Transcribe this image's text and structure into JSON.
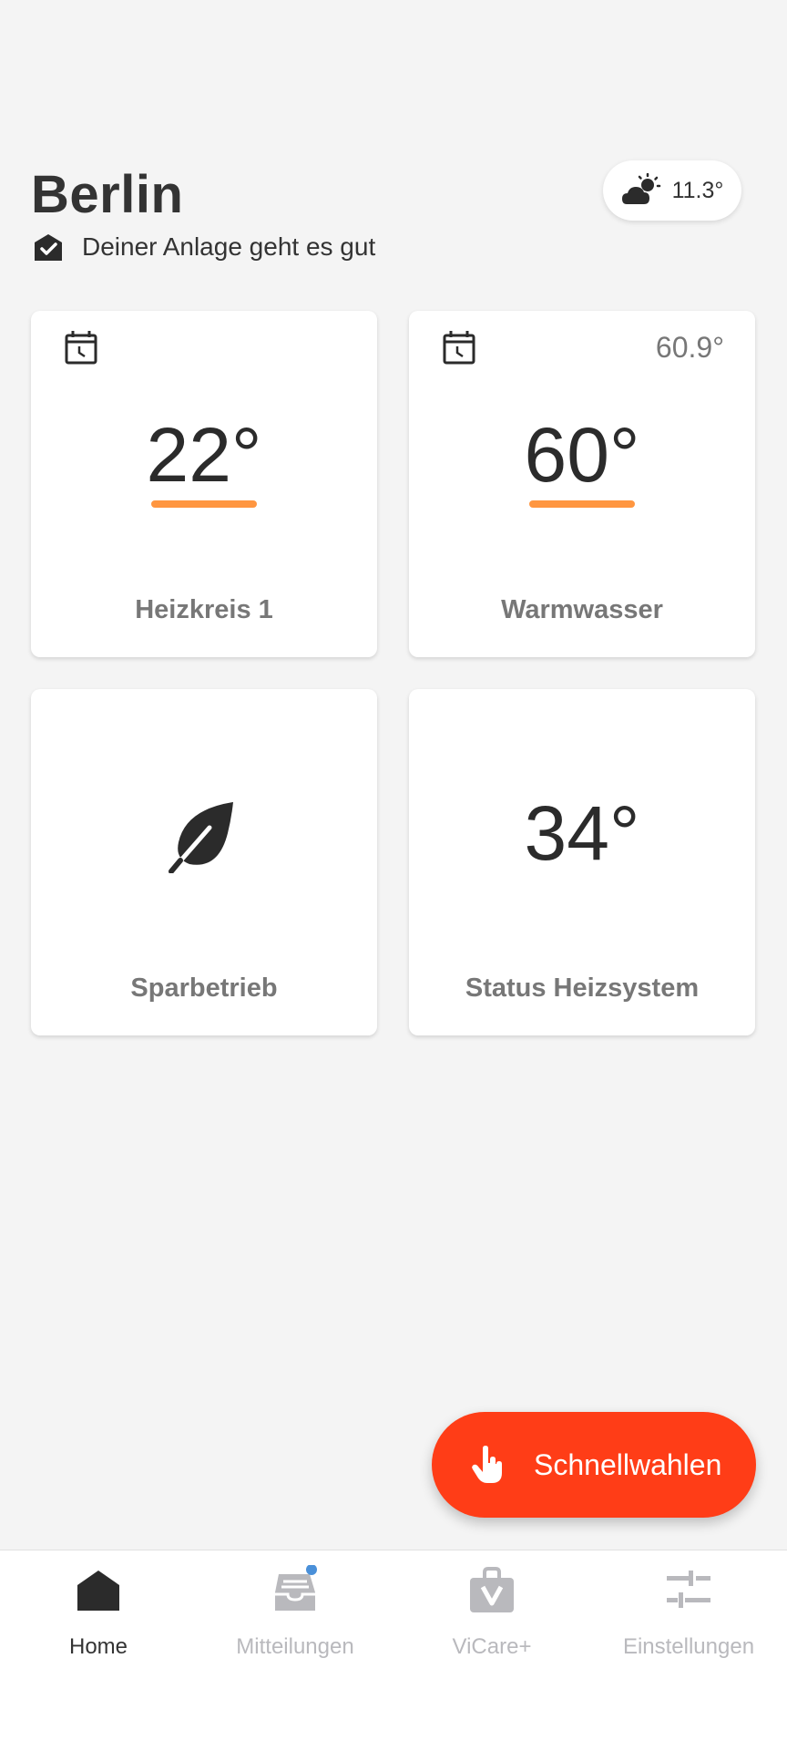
{
  "header": {
    "city": "Berlin",
    "status_text": "Deiner Anlage geht es gut",
    "status_icon": "shield-check-icon",
    "weather": {
      "icon": "partly-cloudy-icon",
      "temp": "11.3°"
    }
  },
  "tiles": [
    {
      "icon": "calendar-clock-icon",
      "value": "22°",
      "label": "Heizkreis 1"
    },
    {
      "icon": "calendar-clock-icon",
      "aux_value": "60.9°",
      "value": "60°",
      "label": "Warmwasser"
    },
    {
      "icon": "leaf-icon",
      "label": "Sparbetrieb"
    },
    {
      "value": "34°",
      "label": "Status Heizsystem"
    }
  ],
  "fab": {
    "icon": "hand-pointer-icon",
    "label": "Schnellwahlen"
  },
  "bottom_nav": [
    {
      "label": "Home",
      "icon": "home-icon",
      "active": true
    },
    {
      "label": "Mitteilungen",
      "icon": "inbox-icon",
      "active": false,
      "badge": true
    },
    {
      "label": "ViCare+",
      "icon": "bag-vicare-icon",
      "active": false
    },
    {
      "label": "Einstellungen",
      "icon": "sliders-icon",
      "active": false
    }
  ],
  "colors": {
    "accent_orange": "#ff9640",
    "fab_red": "#ff3d17",
    "badge_blue": "#4a90d9",
    "background": "#f4f4f4"
  }
}
